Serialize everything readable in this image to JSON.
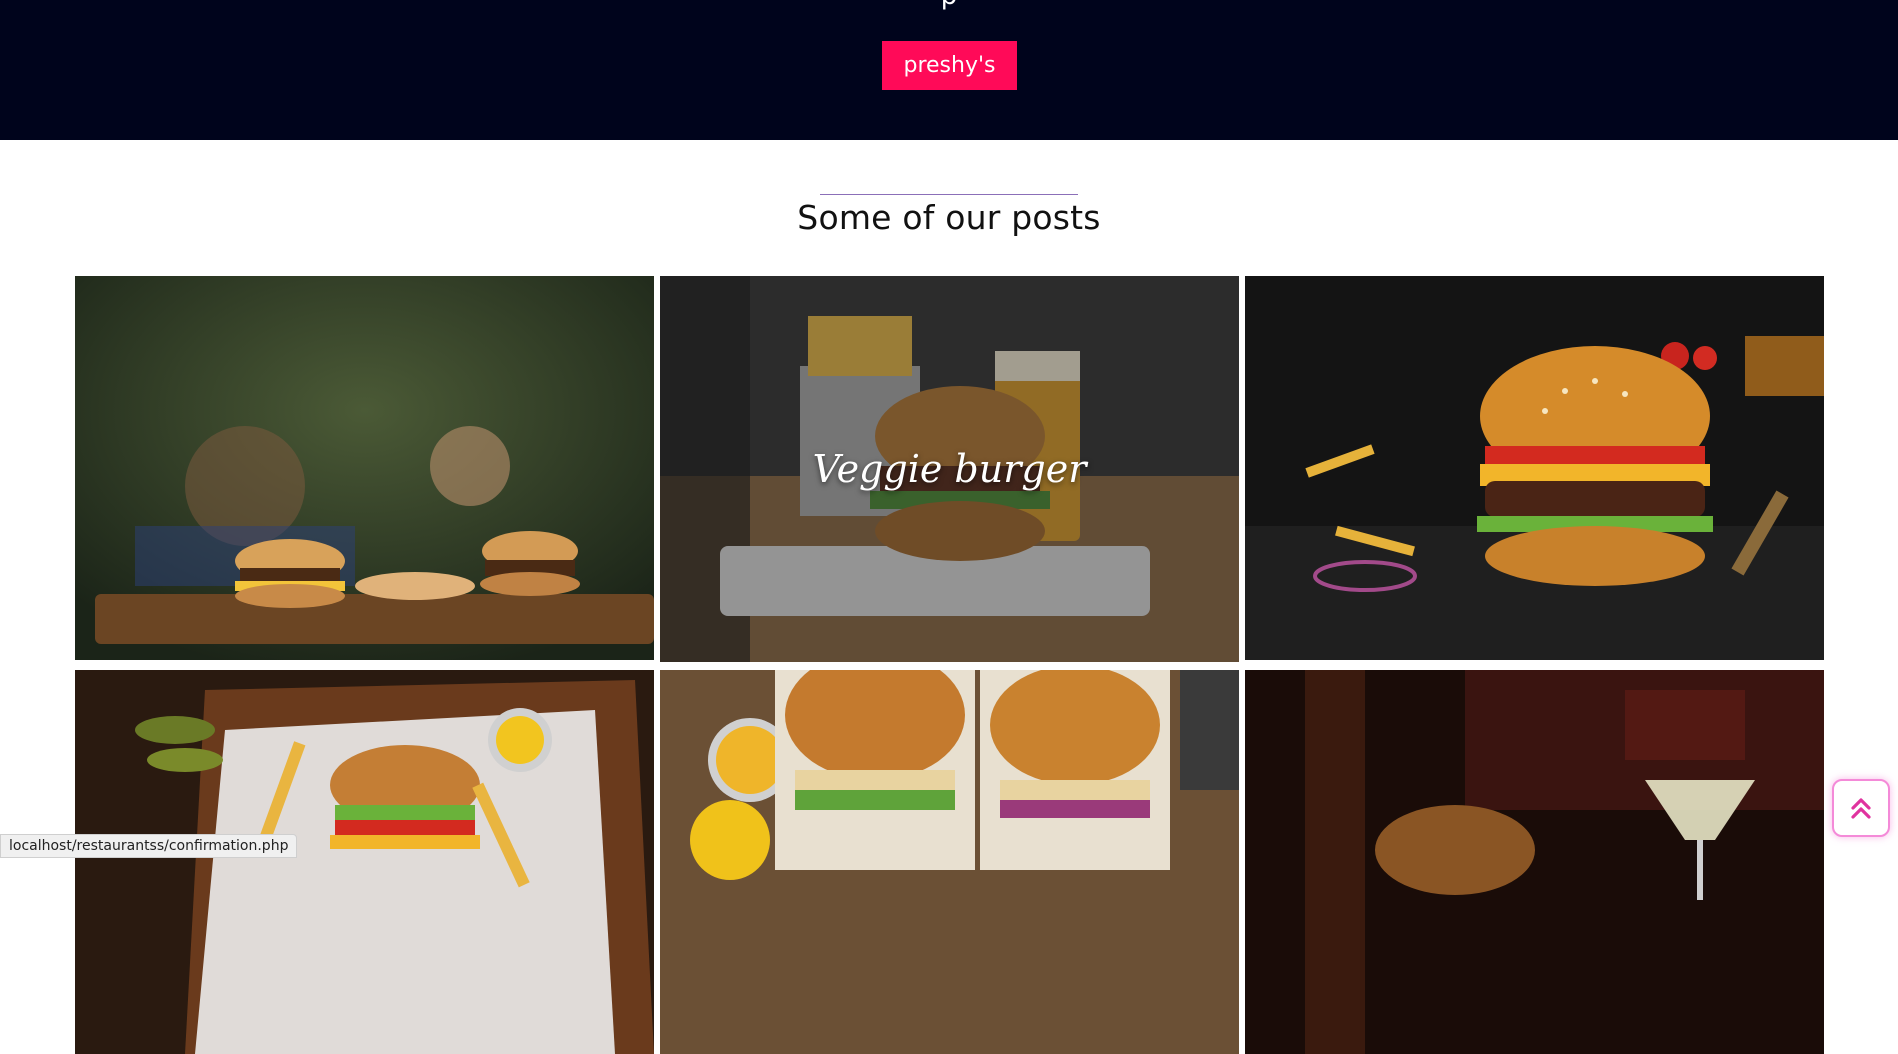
{
  "hero": {
    "clipped_text": "p",
    "brand_button_label": "preshy's"
  },
  "posts_section": {
    "title": "Some of our posts"
  },
  "posts": [
    {
      "caption": "",
      "image": "burgers-on-wooden-board"
    },
    {
      "caption": "Veggie burger",
      "image": "burger-with-fries-bucket"
    },
    {
      "caption": "",
      "image": "cheeseburger-on-slate"
    },
    {
      "caption": "",
      "image": "burger-fries-pickles-mustard"
    },
    {
      "caption": "",
      "image": "two-burgers-with-sauces"
    },
    {
      "caption": "",
      "image": "burger-with-cocktail"
    }
  ],
  "status_bar": {
    "url": "localhost/restaurantss/confirmation.php"
  },
  "scroll_top": {
    "icon": "double-chevron-up-icon",
    "color": "#e0339f"
  },
  "colors": {
    "hero_bg": "#00041c",
    "brand_accent": "#ff0a58"
  }
}
